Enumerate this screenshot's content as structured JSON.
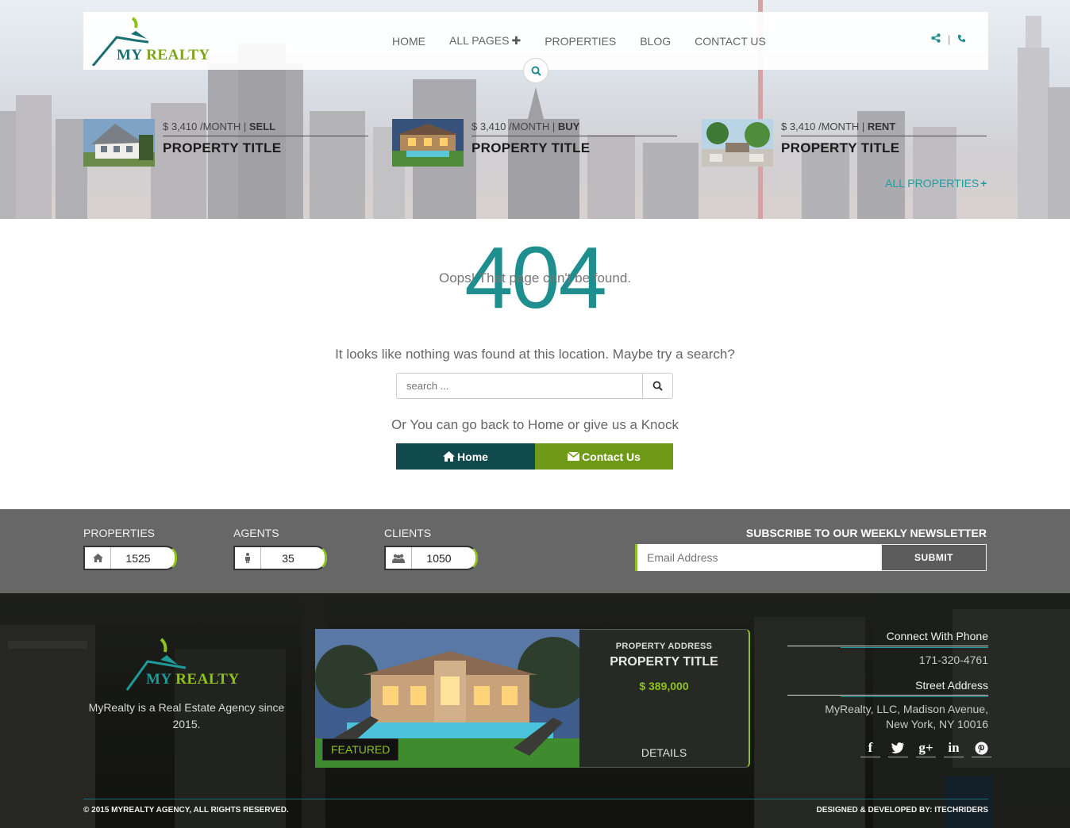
{
  "header": {
    "logo": {
      "my": "MY",
      "realty": "REALTY"
    },
    "nav": [
      {
        "label": "HOME"
      },
      {
        "label": "ALL PAGES",
        "has_plus": true
      },
      {
        "label": "PROPERTIES"
      },
      {
        "label": "BLOG"
      },
      {
        "label": "CONTACT US"
      }
    ],
    "icons": [
      "share-icon",
      "phone-icon",
      "search-icon"
    ],
    "separator": "|"
  },
  "featured_strip": {
    "cards": [
      {
        "price": "$ 3,410 /MONTH |",
        "type": "SELL",
        "title": "PROPERTY TITLE"
      },
      {
        "price": "$ 3,410 /MONTH |",
        "type": "BUY",
        "title": "PROPERTY TITLE"
      },
      {
        "price": "$ 3,410 /MONTH |",
        "type": "RENT",
        "title": "PROPERTY TITLE"
      }
    ],
    "all_link": "ALL PROPERTIES",
    "all_link_icon": "+"
  },
  "error": {
    "code": "404",
    "oops": "Oops! That page can't be found.",
    "message": "It looks like nothing was found at this location. Maybe try a search?",
    "search_placeholder": "search ...",
    "knock": "Or You can go back to Home or give us a Knock",
    "home_button": "Home",
    "contact_button": "Contact Us"
  },
  "stats": {
    "items": [
      {
        "label": "PROPERTIES",
        "value": "1525",
        "icon": "home-icon"
      },
      {
        "label": "AGENTS",
        "value": "35",
        "icon": "person-icon"
      },
      {
        "label": "CLIENTS",
        "value": "1050",
        "icon": "group-icon"
      }
    ],
    "newsletter_title": "SUBSCRIBE TO OUR WEEKLY NEWSLETTER",
    "email_placeholder": "Email Address",
    "submit_label": "SUBMIT"
  },
  "footer": {
    "logo": {
      "my": "MY",
      "realty": "REALTY"
    },
    "about": "MyRealty is a Real Estate Agency since 2015.",
    "featured": {
      "badge": "FEATURED",
      "address_label": "PROPERTY ADDRESS",
      "title": "PROPERTY TITLE",
      "price": "$ 389,000",
      "details": "DETAILS"
    },
    "phone_heading": "Connect With Phone",
    "phone": "171-320-4761",
    "address_heading": "Street Address",
    "address": "MyRealty, LLC, Madison Avenue, New York, NY 10016",
    "social": [
      "facebook-icon",
      "twitter-icon",
      "google-plus-icon",
      "linkedin-icon",
      "pinterest-icon"
    ],
    "copyright": "© 2015 MYREALTY AGENCY, ALL RIGHTS RESERVED.",
    "credit": "DESIGNED & DEVELOPED BY: ITECHRIDERS"
  },
  "colors": {
    "teal": "#1e8e8e",
    "dark_teal": "#114a4c",
    "green": "#6f9a17",
    "lime": "#8ec21a",
    "stats_bg": "#676767"
  }
}
